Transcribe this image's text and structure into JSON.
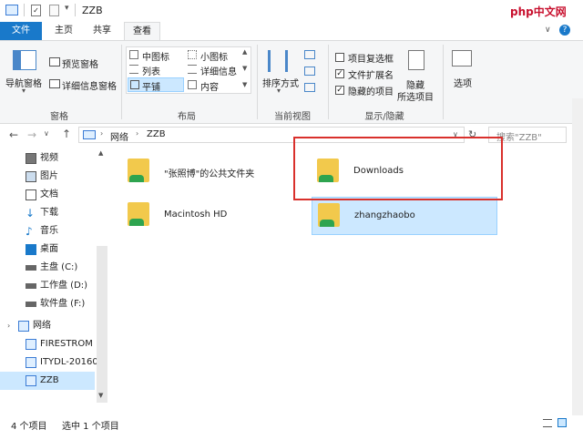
{
  "window": {
    "title": "ZZB",
    "controls": {
      "minimize": "─",
      "maximize": "☐",
      "close": "✕"
    }
  },
  "ribbon_tabs": [
    {
      "label": "文件"
    },
    {
      "label": "主页"
    },
    {
      "label": "共享"
    },
    {
      "label": "查看"
    }
  ],
  "ribbon": {
    "panes": {
      "group_label": "窗格",
      "nav_pane": "导航窗格",
      "preview_pane": "预览窗格",
      "details_pane": "详细信息窗格"
    },
    "layout": {
      "group_label": "布局",
      "items": [
        "中图标",
        "小图标",
        "列表",
        "详细信息",
        "平铺",
        "内容"
      ]
    },
    "current_view": {
      "group_label": "当前视图",
      "sort_by": "排序方式"
    },
    "show_hide": {
      "group_label": "显示/隐藏",
      "item_checkboxes": "项目复选框",
      "file_extensions": "文件扩展名",
      "hidden_items": "隐藏的项目",
      "hide_selected_line1": "隐藏",
      "hide_selected_line2": "所选项目"
    },
    "options": "选项"
  },
  "address": {
    "path": [
      "网络",
      "ZZB"
    ],
    "search_placeholder": "搜索\"ZZB\""
  },
  "nav_items": [
    {
      "label": "视频",
      "icon": "video-icon"
    },
    {
      "label": "图片",
      "icon": "pictures-icon"
    },
    {
      "label": "文档",
      "icon": "documents-icon"
    },
    {
      "label": "下载",
      "icon": "download-icon"
    },
    {
      "label": "音乐",
      "icon": "music-icon"
    },
    {
      "label": "桌面",
      "icon": "desktop-icon"
    },
    {
      "label": "主盘 (C:)",
      "icon": "drive-icon"
    },
    {
      "label": "工作盘 (D:)",
      "icon": "drive-icon"
    },
    {
      "label": "软件盘 (F:)",
      "icon": "drive-icon"
    },
    {
      "label": "网络",
      "icon": "network-icon"
    },
    {
      "label": "FIRESTROM",
      "icon": "computer-icon"
    },
    {
      "label": "ITYDL-20160",
      "icon": "computer-icon"
    },
    {
      "label": "ZZB",
      "icon": "computer-icon"
    }
  ],
  "folders": [
    {
      "label": "\"张照博\"的公共文件夹"
    },
    {
      "label": "Downloads"
    },
    {
      "label": "Macintosh HD"
    },
    {
      "label": "zhangzhaobo"
    }
  ],
  "status": {
    "count": "4 个项目",
    "selected": "选中 1 个项目"
  },
  "watermark": "php中文网",
  "colors": {
    "accent": "#1979ca",
    "selection": "#cce8ff",
    "highlight_box": "#d9302c"
  }
}
